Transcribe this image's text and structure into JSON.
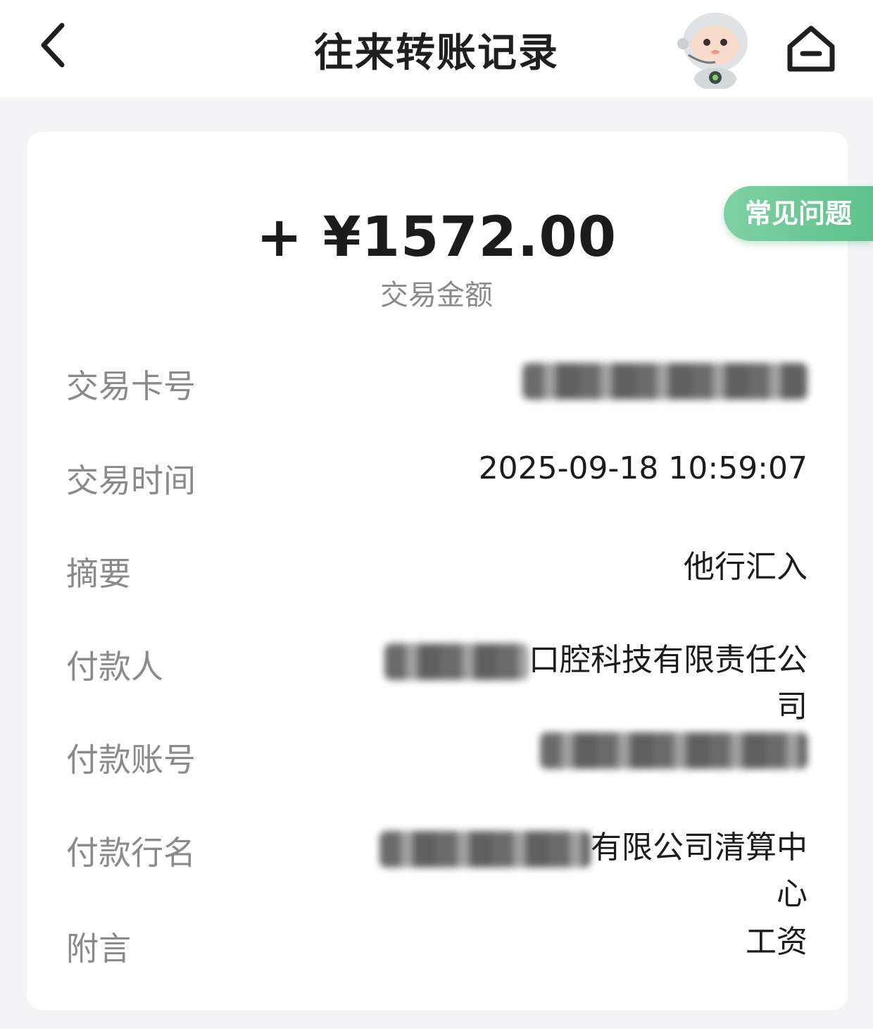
{
  "header": {
    "title": "往来转账记录",
    "back_icon": "chevron-left-icon",
    "mascot": "astronaut-mascot-icon",
    "home_icon": "home-icon"
  },
  "faq_button": "常见问题",
  "amount": {
    "value": "+ ¥1572.00",
    "label": "交易金额"
  },
  "details": {
    "card_no": {
      "label": "交易卡号",
      "value": ""
    },
    "time": {
      "label": "交易时间",
      "value": "2025-09-18 10:59:07"
    },
    "summary": {
      "label": "摘要",
      "value": "他行汇入"
    },
    "payer": {
      "label": "付款人",
      "value_visible_line1": "口腔科技有限责任公",
      "value_visible_line2": "司"
    },
    "payer_account": {
      "label": "付款账号",
      "value": ""
    },
    "payer_bank": {
      "label": "付款行名",
      "value_visible_line1": "有限公司清算中",
      "value_visible_line2": "心"
    },
    "memo": {
      "label": "附言",
      "value": "工资"
    }
  },
  "colors": {
    "accent_green": "#5fc189",
    "text_primary": "#1c1c1c",
    "text_secondary": "#8a8a8a",
    "background": "#f4f4f6"
  }
}
